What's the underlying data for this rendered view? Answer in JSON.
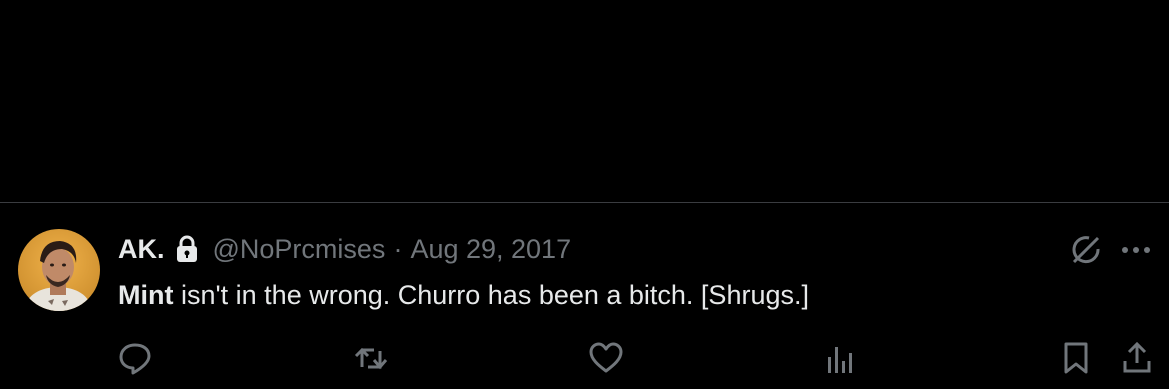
{
  "tweet": {
    "display_name": "AK.",
    "handle": "@NoPrcmises",
    "separator": "·",
    "date": "Aug 29, 2017",
    "text_mention": "Mint",
    "text_rest": " isn't in the wrong. Churro has been a bitch. [Shrugs.]"
  },
  "icons": {
    "lock": "lock-icon",
    "grok": "grok-icon",
    "more": "more-icon",
    "reply": "reply-icon",
    "retweet": "retweet-icon",
    "like": "like-icon",
    "views": "views-icon",
    "bookmark": "bookmark-icon",
    "share": "share-icon"
  },
  "colors": {
    "background": "#000000",
    "text_primary": "#e7e9ea",
    "text_secondary": "#71767b",
    "divider": "#3a3c40"
  }
}
